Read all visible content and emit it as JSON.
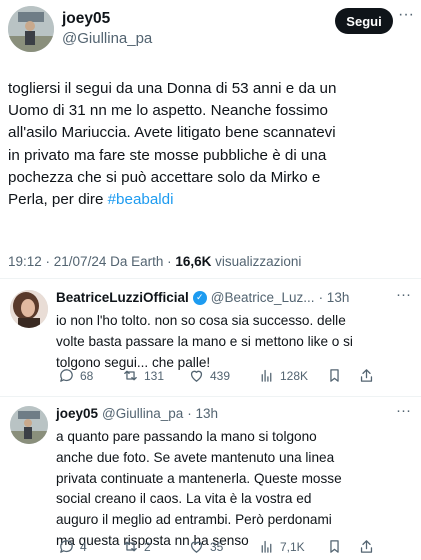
{
  "tweet": {
    "author_name": "joey05",
    "author_handle": "@Giullina_pa",
    "follow_label": "Segui",
    "more_label": "···",
    "text_lines": [
      "togliersi il segui da una Donna di 53 anni e da un",
      "Uomo di 31 nn me lo aspetto. Neanche fossimo",
      "all'asilo Mariuccia. Avete litigato bene  scannatevi",
      "in privato ma fare ste mosse pubbliche è di una",
      "pochezza che si può accettare solo da Mirko e",
      "Perla, per dire "
    ],
    "hashtag": "#beabaldi",
    "timestamp": "19:12 · 21/07/24 Da Earth · ",
    "views_count": "16,6K",
    "views_label": " visualizzazioni"
  },
  "replies": [
    {
      "author_name": "BeatriceLuzziOfficial",
      "author_handle": "@Beatrice_Luz...",
      "time": "· 13h",
      "more_label": "···",
      "text_lines": [
        "io non l'ho tolto. non so cosa sia successo. delle",
        "volte basta passare la mano e si mettono like o si",
        "tolgono segui... che palle!"
      ],
      "counts": {
        "replies": "68",
        "reposts": "131",
        "likes": "439",
        "views": "128K"
      }
    },
    {
      "author_name": "joey05",
      "author_handle": "@Giullina_pa",
      "time": "· 13h",
      "more_label": "···",
      "text_lines": [
        "a quanto pare passando la mano si tolgono",
        "anche due foto. Se avete mantenuto una linea",
        "privata continuate a mantenerla. Queste mosse",
        "social creano il caos. La vita è la vostra ed",
        "auguro il meglio ad entrambi. Però perdonami",
        "ma questa risposta nn ha senso"
      ],
      "counts": {
        "replies": "4",
        "reposts": "2",
        "likes": "35",
        "views": "7,1K"
      }
    }
  ],
  "colors": {
    "accent": "#1d9bf0",
    "text": "#0f1419",
    "muted": "#536471",
    "divider": "#eff3f4"
  }
}
